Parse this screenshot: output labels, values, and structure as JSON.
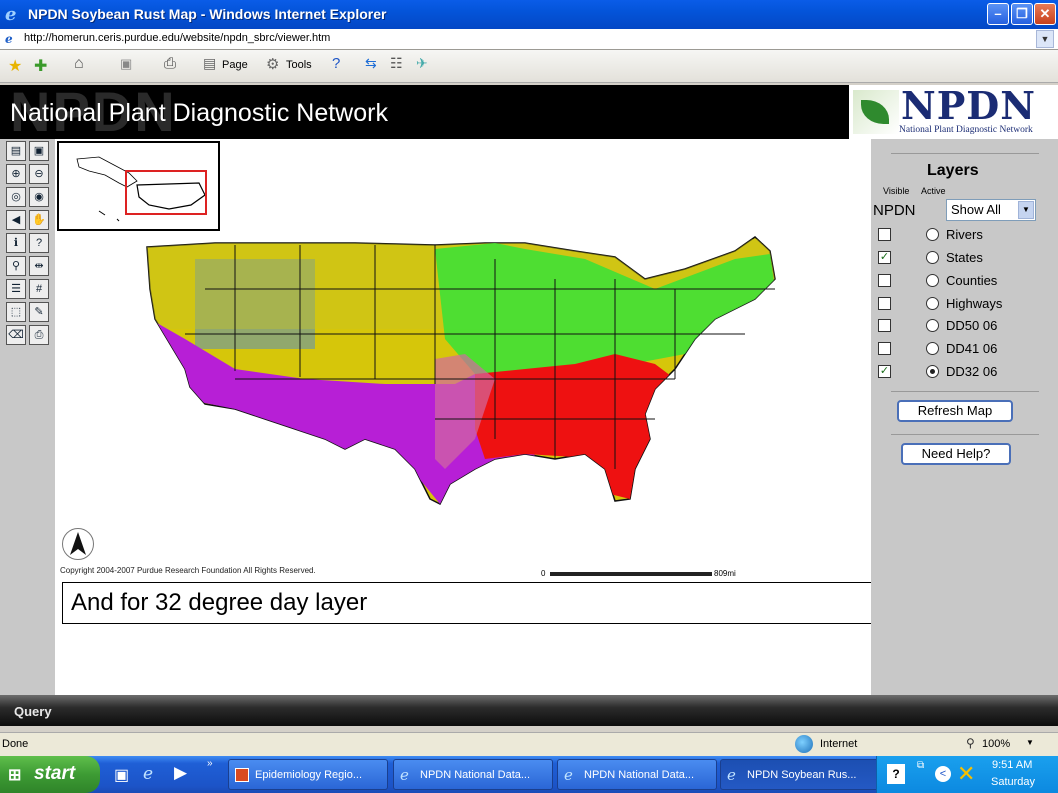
{
  "window": {
    "title": "NPDN Soybean Rust Map - Windows Internet Explorer",
    "url": "http://homerun.ceris.purdue.edu/website/npdn_sbrc/viewer.htm"
  },
  "commandbar": {
    "page_label": "Page",
    "tools_label": "Tools"
  },
  "header": {
    "title": "National Plant Diagnostic Network",
    "watermark": "NPDN",
    "logo_text": "NPDN",
    "logo_subtitle": "National Plant Diagnostic Network"
  },
  "toolbar": {
    "icons": [
      "toc-icon",
      "legend-icon",
      "zoom-in-icon",
      "zoom-out-icon",
      "zoom-full-icon",
      "zoom-active-icon",
      "back-icon",
      "pan-icon",
      "identify-icon",
      "query-icon",
      "find-icon",
      "measure-icon",
      "select-rect-icon",
      "grid-icon",
      "select-shape-icon",
      "buffer-icon",
      "clear-icon",
      "print-icon"
    ]
  },
  "map": {
    "copyright": "Copyright 2004-2007 Purdue Research Foundation All Rights Reserved.",
    "scale_start": "0",
    "scale_end": "809mi",
    "caption": "And for 32 degree day layer",
    "legend_colors": {
      "cool_yellow": "#d8c800",
      "green_overlay": "#3fe035",
      "purple": "#b71fd6",
      "red": "#ee1111",
      "blue_mountain": "#5a90c0"
    }
  },
  "layers": {
    "title": "Layers",
    "visible_label": "Visible",
    "active_label": "Active",
    "group_label": "NPDN",
    "select_value": "Show All",
    "items": [
      {
        "name": "Rivers",
        "visible": false,
        "active": false
      },
      {
        "name": "States",
        "visible": true,
        "active": false
      },
      {
        "name": "Counties",
        "visible": false,
        "active": false
      },
      {
        "name": "Highways",
        "visible": false,
        "active": false
      },
      {
        "name": "DD50 06",
        "visible": false,
        "active": false
      },
      {
        "name": "DD41 06",
        "visible": false,
        "active": false
      },
      {
        "name": "DD32 06",
        "visible": true,
        "active": true
      }
    ],
    "refresh_label": "Refresh Map",
    "help_label": "Need Help?"
  },
  "query": {
    "label": "Query"
  },
  "status": {
    "text": "Done",
    "zone": "Internet",
    "zoom": "100%"
  },
  "taskbar": {
    "start_label": "start",
    "tasks": [
      "Epidemiology Regio...",
      "NPDN National Data...",
      "NPDN National Data...",
      "NPDN Soybean Rus..."
    ],
    "time": "9:51 AM",
    "day": "Saturday"
  }
}
